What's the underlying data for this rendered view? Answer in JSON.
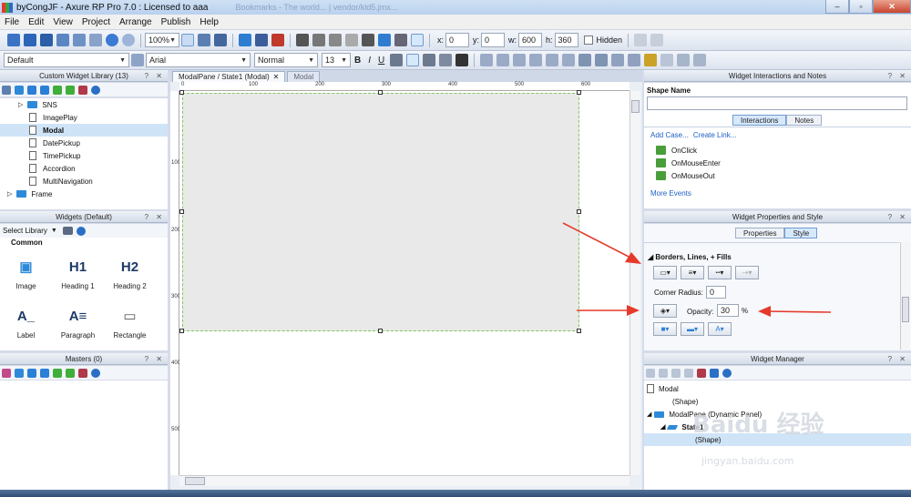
{
  "window": {
    "title": "byCongJF - Axure RP Pro 7.0 : Licensed to aaa",
    "ghost_tab": "Bookmarks - The world... | vendor/kld5.jmx..."
  },
  "menubar": [
    "File",
    "Edit",
    "View",
    "Project",
    "Arrange",
    "Publish",
    "Help"
  ],
  "toolbar": {
    "zoom": "100%",
    "x_label": "x:",
    "x": "0",
    "y_label": "y:",
    "y": "0",
    "w_label": "w:",
    "w": "600",
    "h_label": "h:",
    "h": "360",
    "hidden_label": "Hidden",
    "style": "Default",
    "font": "Arial",
    "weight": "Normal",
    "size": "13",
    "bold": "B",
    "italic": "I",
    "underline": "U"
  },
  "left": {
    "custom_lib_title": "Custom Widget Library (13)",
    "lib_items": [
      "SNS",
      "ImagePlay",
      "Modal",
      "DatePickup",
      "TimePickup",
      "Accordion",
      "MultiNavigation",
      "Frame"
    ],
    "widgets_title": "Widgets (Default)",
    "select_library": "Select Library",
    "common": "Common",
    "widgets": [
      {
        "label": "Image",
        "glyph": "▣"
      },
      {
        "label": "Heading 1",
        "glyph": "H1"
      },
      {
        "label": "Heading 2",
        "glyph": "H2"
      },
      {
        "label": "Label",
        "glyph": "A_"
      },
      {
        "label": "Paragraph",
        "glyph": "A≡"
      },
      {
        "label": "Rectangle",
        "glyph": "▭"
      }
    ],
    "masters_title": "Masters (0)"
  },
  "canvas": {
    "tab_active": "ModalPane / State1 (Modal)",
    "tab_inactive": "Modal",
    "ruler_h": [
      "0",
      "100",
      "200",
      "300",
      "400",
      "500",
      "600"
    ],
    "ruler_v": [
      "100",
      "200",
      "300",
      "400",
      "500"
    ]
  },
  "right": {
    "interactions_title": "Widget Interactions and Notes",
    "shape_name": "Shape Name",
    "tab_interactions": "Interactions",
    "tab_notes": "Notes",
    "add_case": "Add Case...",
    "create_link": "Create Link...",
    "events": [
      "OnClick",
      "OnMouseEnter",
      "OnMouseOut"
    ],
    "more_events": "More Events",
    "props_title": "Widget Properties and Style",
    "tab_properties": "Properties",
    "tab_style": "Style",
    "borders_title": "Borders, Lines, + Fills",
    "corner_radius_label": "Corner Radius:",
    "corner_radius": "0",
    "opacity_label": "Opacity:",
    "opacity": "30",
    "opacity_unit": "%",
    "manager_title": "Widget Manager",
    "manager_items": [
      {
        "label": "Modal",
        "indent": 0
      },
      {
        "label": "(Shape)",
        "indent": 2
      },
      {
        "label": "ModalPane (Dynamic Panel)",
        "indent": 1
      },
      {
        "label": "State1",
        "indent": 2
      },
      {
        "label": "(Shape)",
        "indent": 3
      }
    ]
  },
  "watermark": {
    "main": "Baidu 经验",
    "sub": "jingyan.baidu.com"
  },
  "colors": {
    "accent": "#2e8ad8",
    "arrow": "#e53a2b",
    "selection": "#cfe4f7"
  }
}
